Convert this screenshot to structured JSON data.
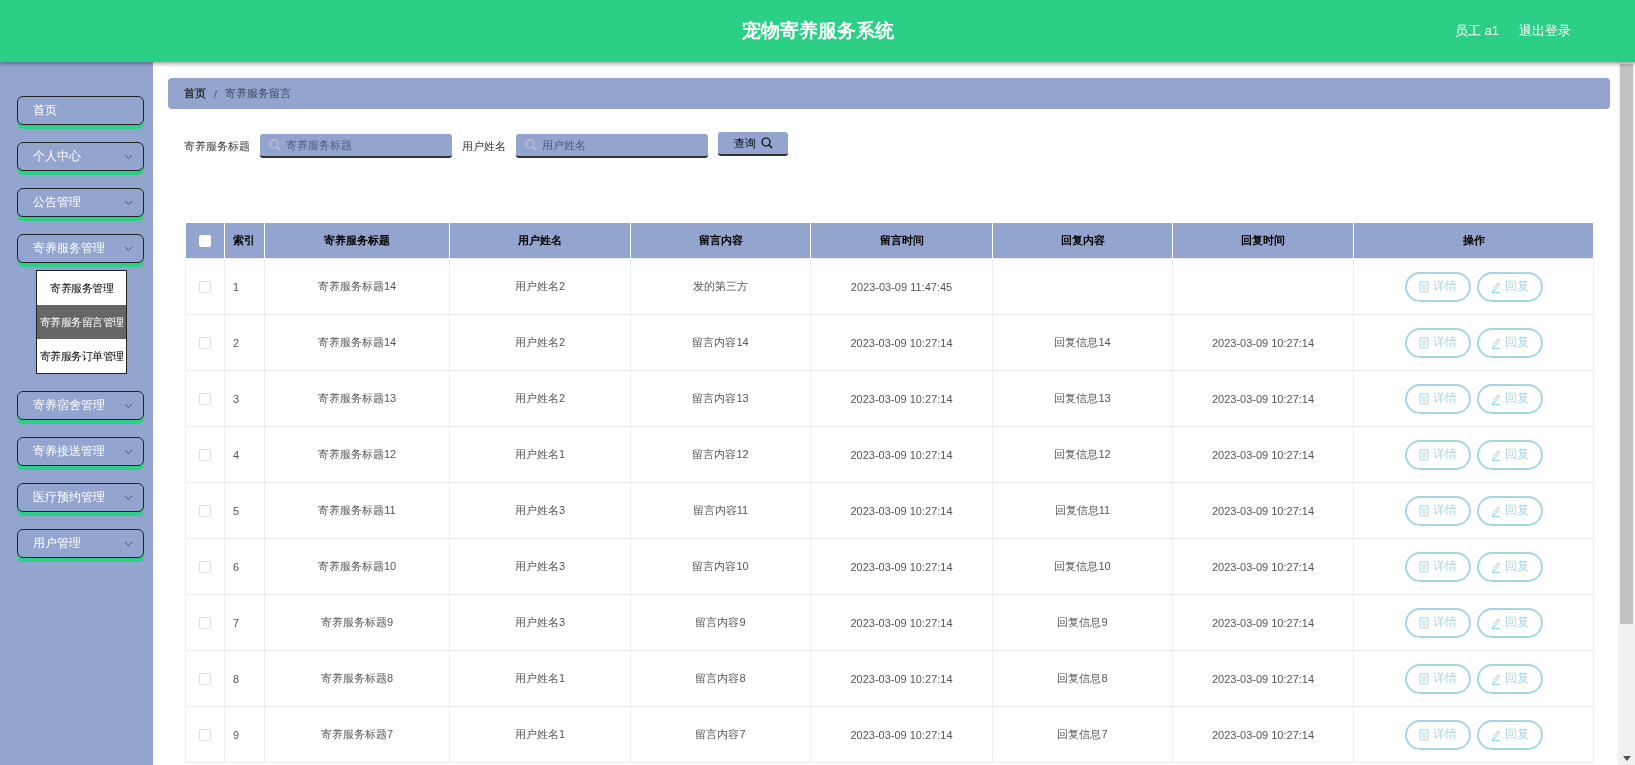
{
  "header": {
    "title": "宠物寄养服务系统",
    "user": "员工 a1",
    "logout": "退出登录"
  },
  "sidebar": {
    "items": [
      {
        "label": "首页",
        "kind": "link"
      },
      {
        "label": "个人中心",
        "kind": "group"
      },
      {
        "label": "公告管理",
        "kind": "group"
      },
      {
        "label": "寄养服务管理",
        "kind": "group",
        "children": [
          {
            "label": "寄养服务管理",
            "selected": false
          },
          {
            "label": "寄养服务留言管理",
            "selected": true
          },
          {
            "label": "寄养服务订单管理",
            "selected": false
          }
        ]
      },
      {
        "label": "寄养宿舍管理",
        "kind": "group"
      },
      {
        "label": "寄养接送管理",
        "kind": "group"
      },
      {
        "label": "医疗预约管理",
        "kind": "group"
      },
      {
        "label": "用户管理",
        "kind": "group"
      }
    ]
  },
  "breadcrumb": {
    "items": [
      "首页",
      "寄养服务留言"
    ],
    "separator": "/"
  },
  "search": {
    "fields": [
      {
        "label": "寄养服务标题",
        "placeholder": "寄养服务标题"
      },
      {
        "label": "用户姓名",
        "placeholder": "用户姓名"
      }
    ],
    "button": "查询"
  },
  "table": {
    "select_all": {
      "checked": false
    },
    "columns": [
      "索引",
      "寄养服务标题",
      "用户姓名",
      "留言内容",
      "留言时间",
      "回复内容",
      "回复时间",
      "操作"
    ],
    "rows": [
      {
        "checked": false,
        "cells": [
          "1",
          "寄养服务标题14",
          "用户姓名2",
          "发的第三方",
          "2023-03-09 11:47:45"
        ],
        "actions": [
          "详情",
          "回复"
        ]
      },
      {
        "checked": false,
        "cells": [
          "2",
          "寄养服务标题14",
          "用户姓名2",
          "留言内容14",
          "2023-03-09 10:27:14",
          "回复信息14",
          "2023-03-09 10:27:14"
        ],
        "actions": [
          "详情",
          "回复"
        ]
      },
      {
        "checked": false,
        "cells": [
          "3",
          "寄养服务标题13",
          "用户姓名2",
          "留言内容13",
          "2023-03-09 10:27:14",
          "回复信息13",
          "2023-03-09 10:27:14"
        ],
        "actions": [
          "详情",
          "回复"
        ]
      },
      {
        "checked": false,
        "cells": [
          "4",
          "寄养服务标题12",
          "用户姓名1",
          "留言内容12",
          "2023-03-09 10:27:14",
          "回复信息12",
          "2023-03-09 10:27:14"
        ],
        "actions": [
          "详情",
          "回复"
        ]
      },
      {
        "checked": false,
        "cells": [
          "5",
          "寄养服务标题11",
          "用户姓名3",
          "留言内容11",
          "2023-03-09 10:27:14",
          "回复信息11",
          "2023-03-09 10:27:14"
        ],
        "actions": [
          "详情",
          "回复"
        ]
      },
      {
        "checked": false,
        "cells": [
          "6",
          "寄养服务标题10",
          "用户姓名3",
          "留言内容10",
          "2023-03-09 10:27:14",
          "回复信息10",
          "2023-03-09 10:27:14"
        ],
        "actions": [
          "详情",
          "回复"
        ]
      },
      {
        "checked": false,
        "cells": [
          "7",
          "寄养服务标题9",
          "用户姓名3",
          "留言内容9",
          "2023-03-09 10:27:14",
          "回复信息9",
          "2023-03-09 10:27:14"
        ],
        "actions": [
          "详情",
          "回复"
        ]
      },
      {
        "checked": false,
        "cells": [
          "8",
          "寄养服务标题8",
          "用户姓名1",
          "留言内容8",
          "2023-03-09 10:27:14",
          "回复信息8",
          "2023-03-09 10:27:14"
        ],
        "actions": [
          "详情",
          "回复"
        ]
      },
      {
        "checked": false,
        "cells": [
          "9",
          "寄养服务标题7",
          "用户姓名1",
          "留言内容7",
          "2023-03-09 10:27:14",
          "回复信息7",
          "2023-03-09 10:27:14"
        ],
        "actions": [
          "详情",
          "回复"
        ]
      }
    ]
  }
}
